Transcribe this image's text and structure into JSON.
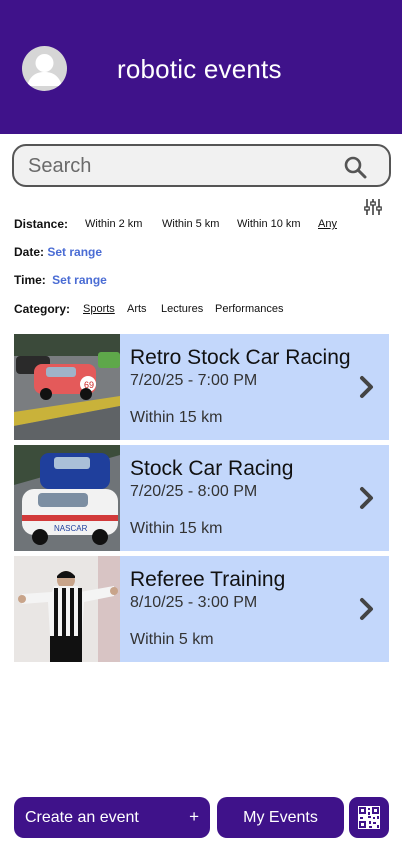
{
  "header": {
    "title": "robotic events",
    "avatar_icon": "user-avatar-icon",
    "background": "#3f128a"
  },
  "search": {
    "placeholder": "Search",
    "icon": "search-icon"
  },
  "filters": {
    "icon": "sliders-icon",
    "distance": {
      "label": "Distance:",
      "options": [
        "Within 2 km",
        "Within 5 km",
        "Within 10 km",
        "Any"
      ],
      "selected": "Any"
    },
    "date": {
      "label": "Date:",
      "value": "Set range"
    },
    "time": {
      "label": "Time:",
      "value": "Set range"
    },
    "category": {
      "label": "Category:",
      "options": [
        "Sports",
        "Arts",
        "Lectures",
        "Performances"
      ],
      "selected": "Sports"
    }
  },
  "events": [
    {
      "title": "Retro Stock Car Racing",
      "datetime": "7/20/25 - 7:00 PM",
      "distance": "Within 15 km",
      "image": "retro-stock-car-photo"
    },
    {
      "title": "Stock Car Racing",
      "datetime": "7/20/25 - 8:00 PM",
      "distance": "Within 15 km",
      "image": "stock-car-photo"
    },
    {
      "title": "Referee Training",
      "datetime": "8/10/25 - 3:00 PM",
      "distance": "Within 5 km",
      "image": "referee-photo"
    }
  ],
  "footer": {
    "create_label": "Create an event",
    "create_plus": "+",
    "my_events_label": "My Events",
    "qr_icon": "qr-code-icon"
  },
  "colors": {
    "primary": "#3f128a",
    "card": "#c3d7fb",
    "link": "#4a6cd4"
  }
}
